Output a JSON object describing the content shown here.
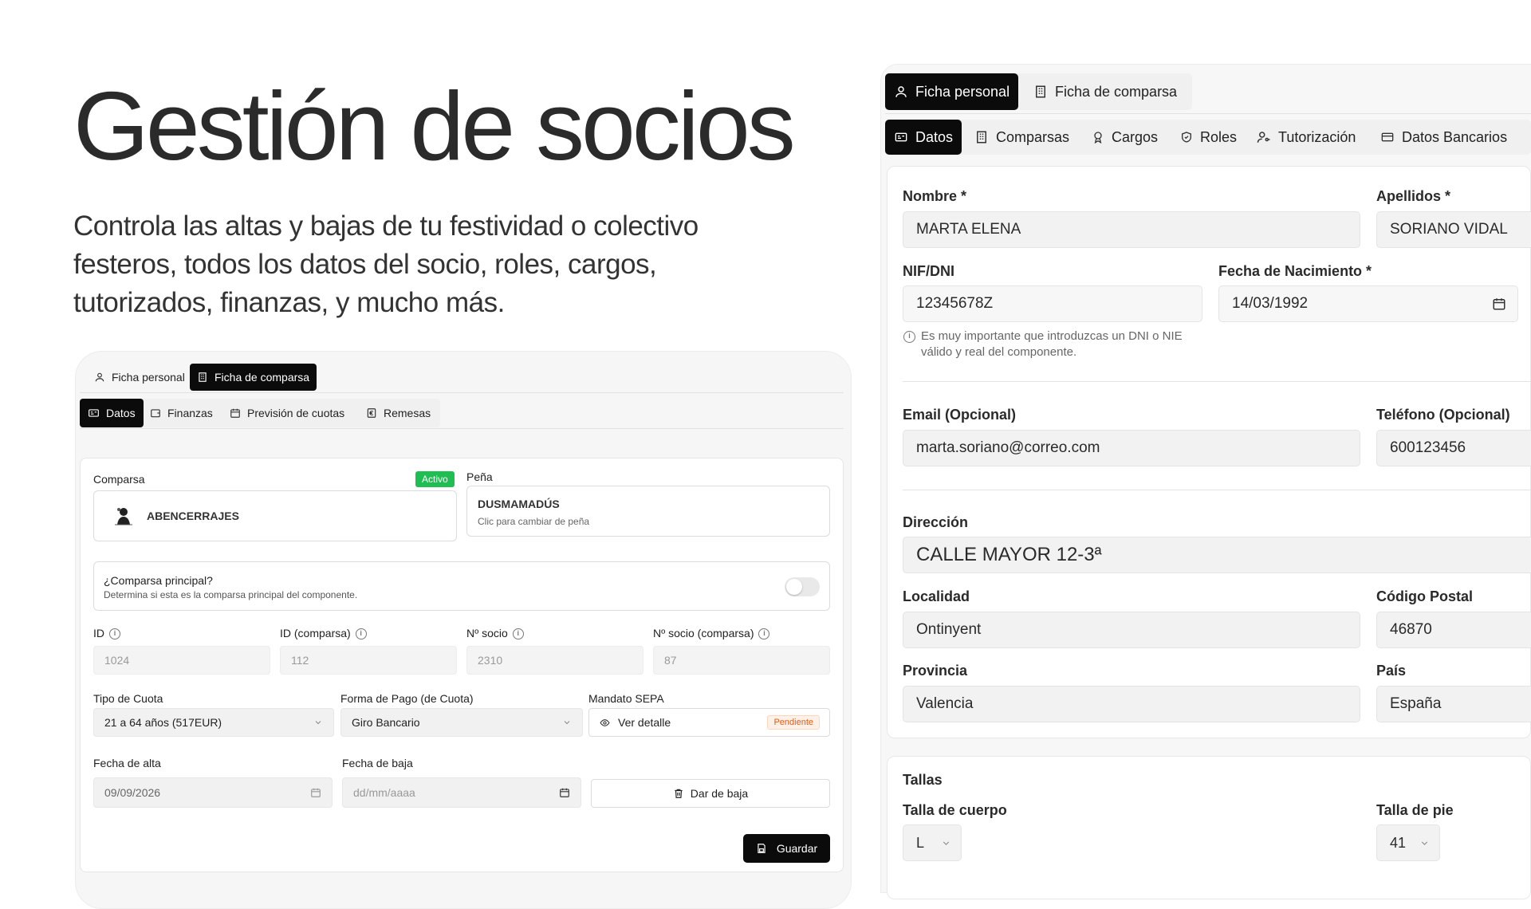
{
  "hero": {
    "title": "Gestión de socios",
    "subtitle": "Controla las altas y bajas de tu festividad o colectivo festeros, todos los datos del socio, roles, cargos, tutorizados, finanzas, y mucho más."
  },
  "left": {
    "top_tabs": [
      {
        "label": "Ficha personal",
        "icon": "user-icon",
        "active": false
      },
      {
        "label": "Ficha de comparsa",
        "icon": "building-icon",
        "active": true
      }
    ],
    "sub_tabs": [
      {
        "label": "Datos",
        "icon": "id-card-icon",
        "active": true
      },
      {
        "label": "Finanzas",
        "icon": "wallet-icon",
        "active": false
      },
      {
        "label": "Previsión de cuotas",
        "icon": "calendar-icon",
        "active": false
      },
      {
        "label": "Remesas",
        "icon": "euro-receipt-icon",
        "active": false
      }
    ],
    "comparsa": {
      "label": "Comparsa",
      "badge": "Activo",
      "value": "ABENCERRAJES"
    },
    "pena": {
      "label": "Peña",
      "value": "DUSMAMADÚS",
      "hint": "Clic para cambiar de peña"
    },
    "principal": {
      "title": "¿Comparsa principal?",
      "desc": "Determina si esta es la comparsa principal del componente.",
      "on": false
    },
    "ids": [
      {
        "label": "ID",
        "value": "1024"
      },
      {
        "label": "ID (comparsa)",
        "value": "112"
      },
      {
        "label": "Nº socio",
        "value": "2310"
      },
      {
        "label": "Nº socio (comparsa)",
        "value": "87"
      }
    ],
    "tipo_cuota": {
      "label": "Tipo de Cuota",
      "value": "21 a 64 años (517EUR)"
    },
    "forma_pago": {
      "label": "Forma de Pago (de Cuota)",
      "value": "Giro Bancario"
    },
    "mandato": {
      "label": "Mandato SEPA",
      "action": "Ver detalle",
      "status": "Pendiente"
    },
    "fecha_alta": {
      "label": "Fecha de alta",
      "value": "09/09/2026"
    },
    "fecha_baja": {
      "label": "Fecha de baja",
      "placeholder": "dd/mm/aaaa"
    },
    "dar_baja": "Dar de baja",
    "guardar": "Guardar"
  },
  "right": {
    "top_tabs": [
      {
        "label": "Ficha personal",
        "icon": "user-icon",
        "active": true
      },
      {
        "label": "Ficha de comparsa",
        "icon": "building-icon",
        "active": false
      }
    ],
    "sub_tabs": [
      {
        "label": "Datos",
        "icon": "id-card-icon",
        "active": true
      },
      {
        "label": "Comparsas",
        "icon": "building-icon",
        "active": false
      },
      {
        "label": "Cargos",
        "icon": "award-icon",
        "active": false
      },
      {
        "label": "Roles",
        "icon": "shield-icon",
        "active": false
      },
      {
        "label": "Tutorización",
        "icon": "user-key-icon",
        "active": false
      },
      {
        "label": "Datos Bancarios",
        "icon": "credit-card-icon",
        "active": false
      }
    ],
    "nombre": {
      "label": "Nombre *",
      "value": "MARTA ELENA"
    },
    "apellidos": {
      "label": "Apellidos *",
      "value": "SORIANO VIDAL"
    },
    "nif": {
      "label": "NIF/DNI",
      "value": "12345678Z",
      "help": "Es muy importante que introduzcas un DNI o NIE válido y real del componente."
    },
    "nacimiento": {
      "label": "Fecha de Nacimiento *",
      "value": "14/03/1992"
    },
    "email": {
      "label": "Email (Opcional)",
      "value": "marta.soriano@correo.com"
    },
    "telefono": {
      "label": "Teléfono (Opcional)",
      "value": "600123456"
    },
    "direccion": {
      "label": "Dirección",
      "value": "CALLE MAYOR 12-3ª"
    },
    "localidad": {
      "label": "Localidad",
      "value": "Ontinyent"
    },
    "cp": {
      "label": "Código Postal",
      "value": "46870"
    },
    "provincia": {
      "label": "Provincia",
      "value": "Valencia"
    },
    "pais": {
      "label": "País",
      "value": "España"
    },
    "tallas": {
      "title": "Tallas",
      "cuerpo_label": "Talla de cuerpo",
      "cuerpo": "L",
      "pie_label": "Talla de pie",
      "pie": "41"
    }
  }
}
